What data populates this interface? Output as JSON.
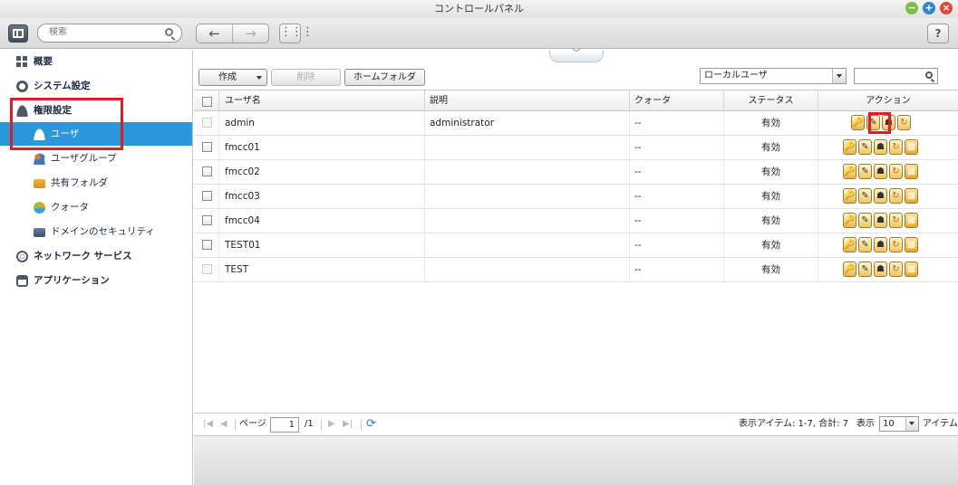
{
  "window": {
    "title": "コントロールパネル"
  },
  "toolbar": {
    "search_placeholder": "検索",
    "help_label": "?"
  },
  "sidebar": {
    "items": [
      {
        "label": "概要"
      },
      {
        "label": "システム設定"
      },
      {
        "label": "権限設定"
      },
      {
        "label": "ユーザ"
      },
      {
        "label": "ユーザグループ"
      },
      {
        "label": "共有フォルダ"
      },
      {
        "label": "クォータ"
      },
      {
        "label": "ドメインのセキュリティ"
      },
      {
        "label": "ネットワーク サービス"
      },
      {
        "label": "アプリケーション"
      }
    ]
  },
  "main": {
    "create_label": "作成",
    "delete_label": "削除",
    "home_folder_label": "ホームフォルダ",
    "user_type_selected": "ローカルユーザ",
    "columns": {
      "name": "ユーザ名",
      "desc": "説明",
      "quota": "クォータ",
      "status": "ステータス",
      "action": "アクション"
    },
    "rows": [
      {
        "name": "admin",
        "desc": "administrator",
        "quota": "--",
        "status": "有効"
      },
      {
        "name": "fmcc01",
        "desc": "",
        "quota": "--",
        "status": "有効"
      },
      {
        "name": "fmcc02",
        "desc": "",
        "quota": "--",
        "status": "有効"
      },
      {
        "name": "fmcc03",
        "desc": "",
        "quota": "--",
        "status": "有効"
      },
      {
        "name": "fmcc04",
        "desc": "",
        "quota": "--",
        "status": "有効"
      },
      {
        "name": "TEST01",
        "desc": "",
        "quota": "--",
        "status": "有効"
      },
      {
        "name": "TEST",
        "desc": "",
        "quota": "--",
        "status": "有効"
      }
    ]
  },
  "pager": {
    "page_label": "ページ",
    "page_value": "1",
    "page_total": "/1",
    "summary": "表示アイテム: 1-7, 合計: 7",
    "show_label": "表示",
    "per_page": "10",
    "items_label": "アイテム"
  },
  "colors": {
    "accent": "#2b97dd",
    "highlight": "#e41b23"
  }
}
